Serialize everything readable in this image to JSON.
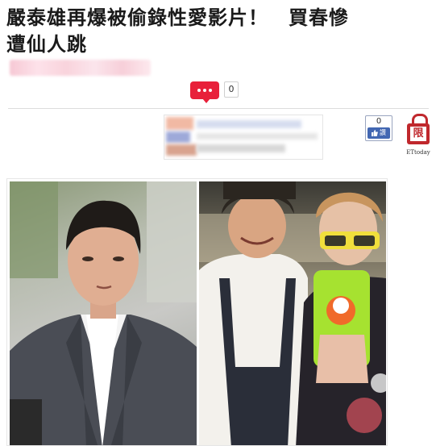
{
  "article": {
    "title_line1": "嚴泰雄再爆被偷錄性愛影片！　買春慘",
    "title_line2": "遭仙人跳"
  },
  "comments": {
    "icon": "speech-bubble-icon",
    "count": "0"
  },
  "facebook": {
    "count": "0",
    "button_label": "讚",
    "icon": "thumbs-up-icon",
    "color": "#4267b2"
  },
  "rating_badge": {
    "label": "限",
    "caption": "ETtoday",
    "icon": "lock-icon",
    "color": "#c0282d"
  },
  "accent": {
    "comment_red": "#e8203a"
  }
}
